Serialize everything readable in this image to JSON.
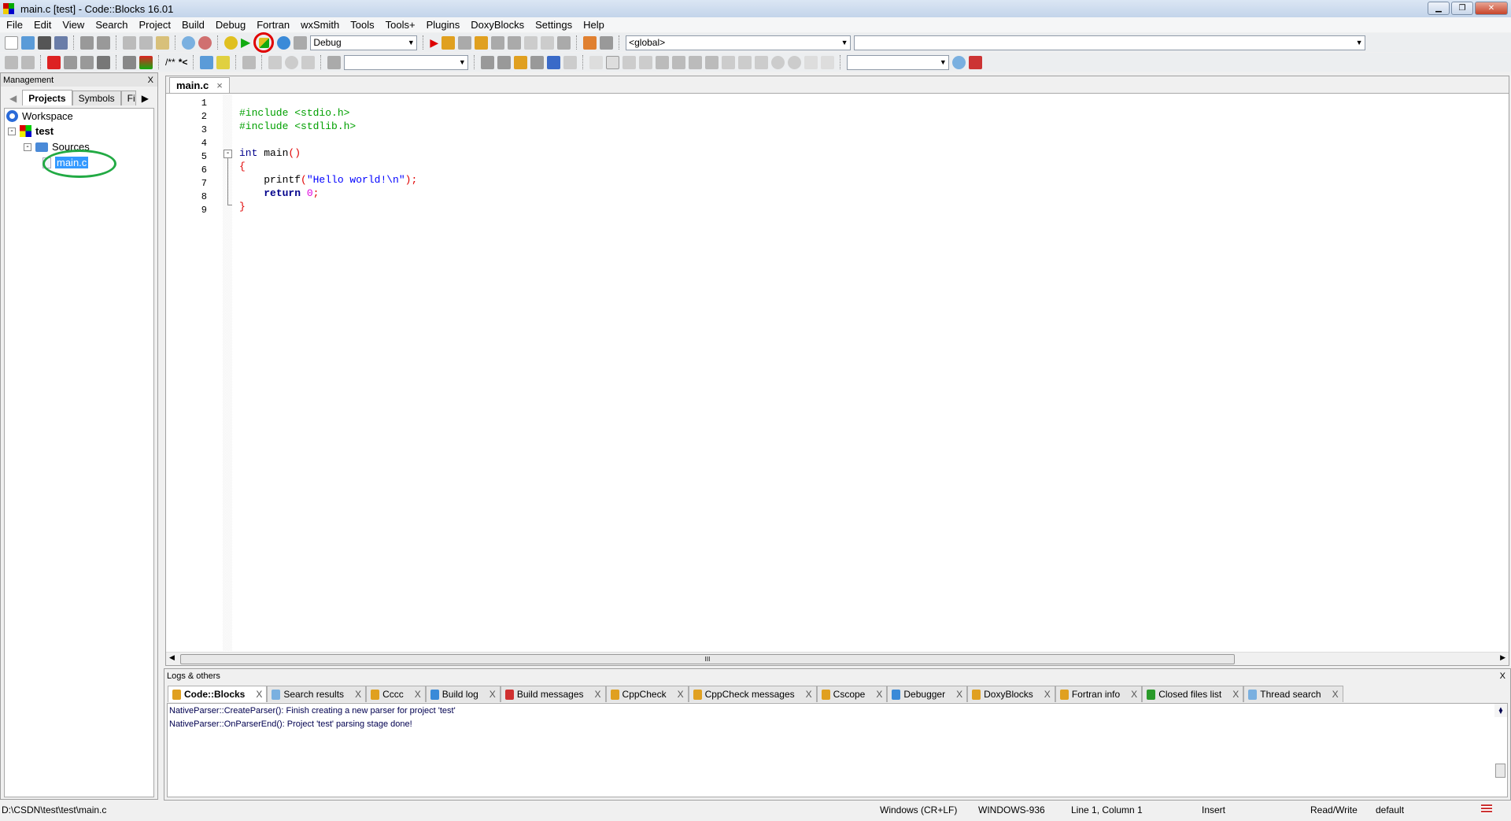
{
  "window": {
    "title": "main.c [test] - Code::Blocks 16.01"
  },
  "menu": [
    "File",
    "Edit",
    "View",
    "Search",
    "Project",
    "Build",
    "Debug",
    "Fortran",
    "wxSmith",
    "Tools",
    "Tools+",
    "Plugins",
    "DoxyBlocks",
    "Settings",
    "Help"
  ],
  "toolbar": {
    "build_target": "Debug",
    "scope": "<global>",
    "symbol": "",
    "search": "",
    "doc_comment1": "/**",
    "doc_comment2": "*<",
    "highlighted_button": "build-and-run",
    "highlight_color": "#e00000"
  },
  "management": {
    "title": "Management",
    "close": "X",
    "tabs": [
      "Projects",
      "Symbols",
      "Files"
    ],
    "active_tab": "Projects",
    "tree": {
      "workspace": "Workspace",
      "project": "test",
      "folder": "Sources",
      "file": "main.c"
    },
    "file_highlight_color": "#22aa44"
  },
  "editor": {
    "tab": "main.c",
    "tab_close": "×",
    "lines": [
      "1",
      "2",
      "3",
      "4",
      "5",
      "6",
      "7",
      "8",
      "9"
    ]
  },
  "logs": {
    "title": "Logs & others",
    "close": "X",
    "tabs": [
      "Code::Blocks",
      "Search results",
      "Cccc",
      "Build log",
      "Build messages",
      "CppCheck",
      "CppCheck messages",
      "Cscope",
      "Debugger",
      "DoxyBlocks",
      "Fortran info",
      "Closed files list",
      "Thread search"
    ],
    "active_tab": "Code::Blocks",
    "messages": [
      "NativeParser::CreateParser(): Finish creating a new parser for project 'test'",
      "NativeParser::OnParserEnd(): Project 'test' parsing stage done!"
    ]
  },
  "status": {
    "path": "D:\\CSDN\\test\\test\\main.c",
    "eol": "Windows (CR+LF)",
    "encoding": "WINDOWS-936",
    "position": "Line 1, Column 1",
    "mode": "Insert",
    "access": "Read/Write",
    "profile": "default"
  }
}
